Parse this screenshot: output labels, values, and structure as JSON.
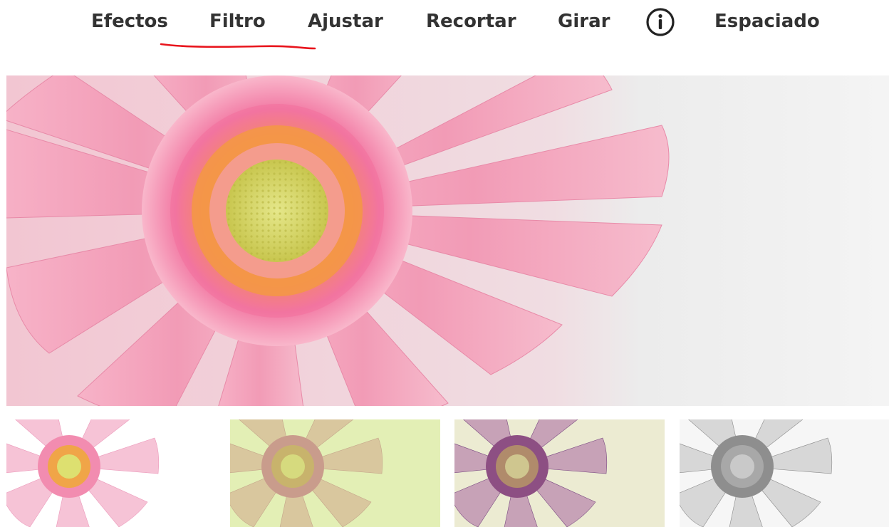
{
  "toolbar": {
    "tabs": [
      {
        "label": "Efectos"
      },
      {
        "label": "Filtro",
        "active": true
      },
      {
        "label": "Ajustar"
      },
      {
        "label": "Recortar"
      },
      {
        "label": "Girar"
      },
      {
        "label": "Espaciado"
      }
    ],
    "info_icon": "info-circle-icon",
    "active_underline_color": "#e8141c"
  },
  "preview": {
    "subject": "pink gerbera daisy close-up",
    "background_color": "#ececec",
    "petal_color": "#f4a3bd",
    "center_color": "#d7d86a"
  },
  "filters": [
    {
      "name": "filter-original-light",
      "tint": "#ffffff"
    },
    {
      "name": "filter-yellow-green",
      "tint": "#e3efb5"
    },
    {
      "name": "filter-purple-cream",
      "tint": "#ecebd2"
    },
    {
      "name": "filter-grayscale",
      "tint": "#f3f3f3"
    }
  ]
}
